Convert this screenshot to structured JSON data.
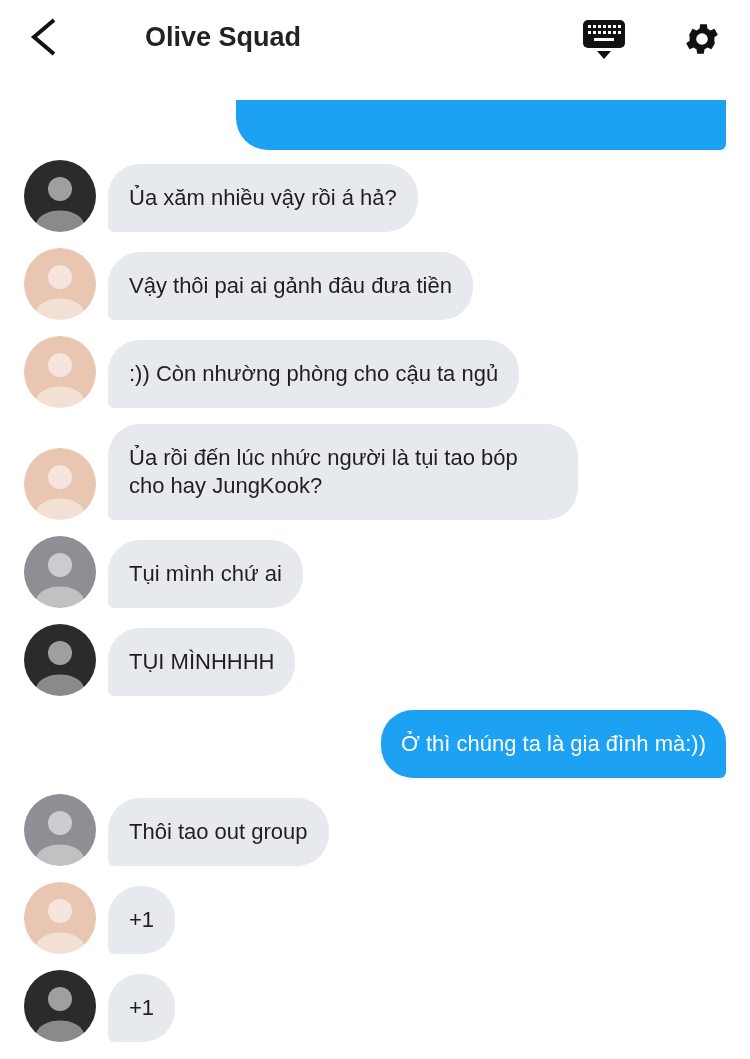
{
  "header": {
    "title": "Olive Squad"
  },
  "clipped_bubble": {
    "kind": "outgoing"
  },
  "messages": [
    {
      "kind": "incoming",
      "text": "Ủa xăm nhiều vậy rồi á hả?",
      "color": "#2b2b2e"
    },
    {
      "kind": "incoming",
      "text": "Vậy thôi pai ai gảnh đâu đưa tiền",
      "color": "#e9c6b2"
    },
    {
      "kind": "incoming",
      "text": ":)) Còn nhường phòng cho cậu ta ngủ",
      "color": "#e9c6b2"
    },
    {
      "kind": "incoming",
      "text": "Ủa rồi đến lúc nhức người là tụi tao bóp cho hay JungKook?",
      "color": "#e9c6b2"
    },
    {
      "kind": "incoming",
      "text": "Tụi mình chứ ai",
      "color": "#8e8e94"
    },
    {
      "kind": "incoming",
      "text": "TỤI MÌNHHHH",
      "color": "#2b2b2e"
    },
    {
      "kind": "outgoing",
      "text": "Ở thì chúng ta là gia đình mà:))"
    },
    {
      "kind": "incoming",
      "text": "Thôi tao out group",
      "color": "#8e8e94"
    },
    {
      "kind": "incoming",
      "text": "+1",
      "color": "#e9c6b2"
    },
    {
      "kind": "incoming",
      "text": "+1",
      "color": "#2b2b2e"
    }
  ]
}
